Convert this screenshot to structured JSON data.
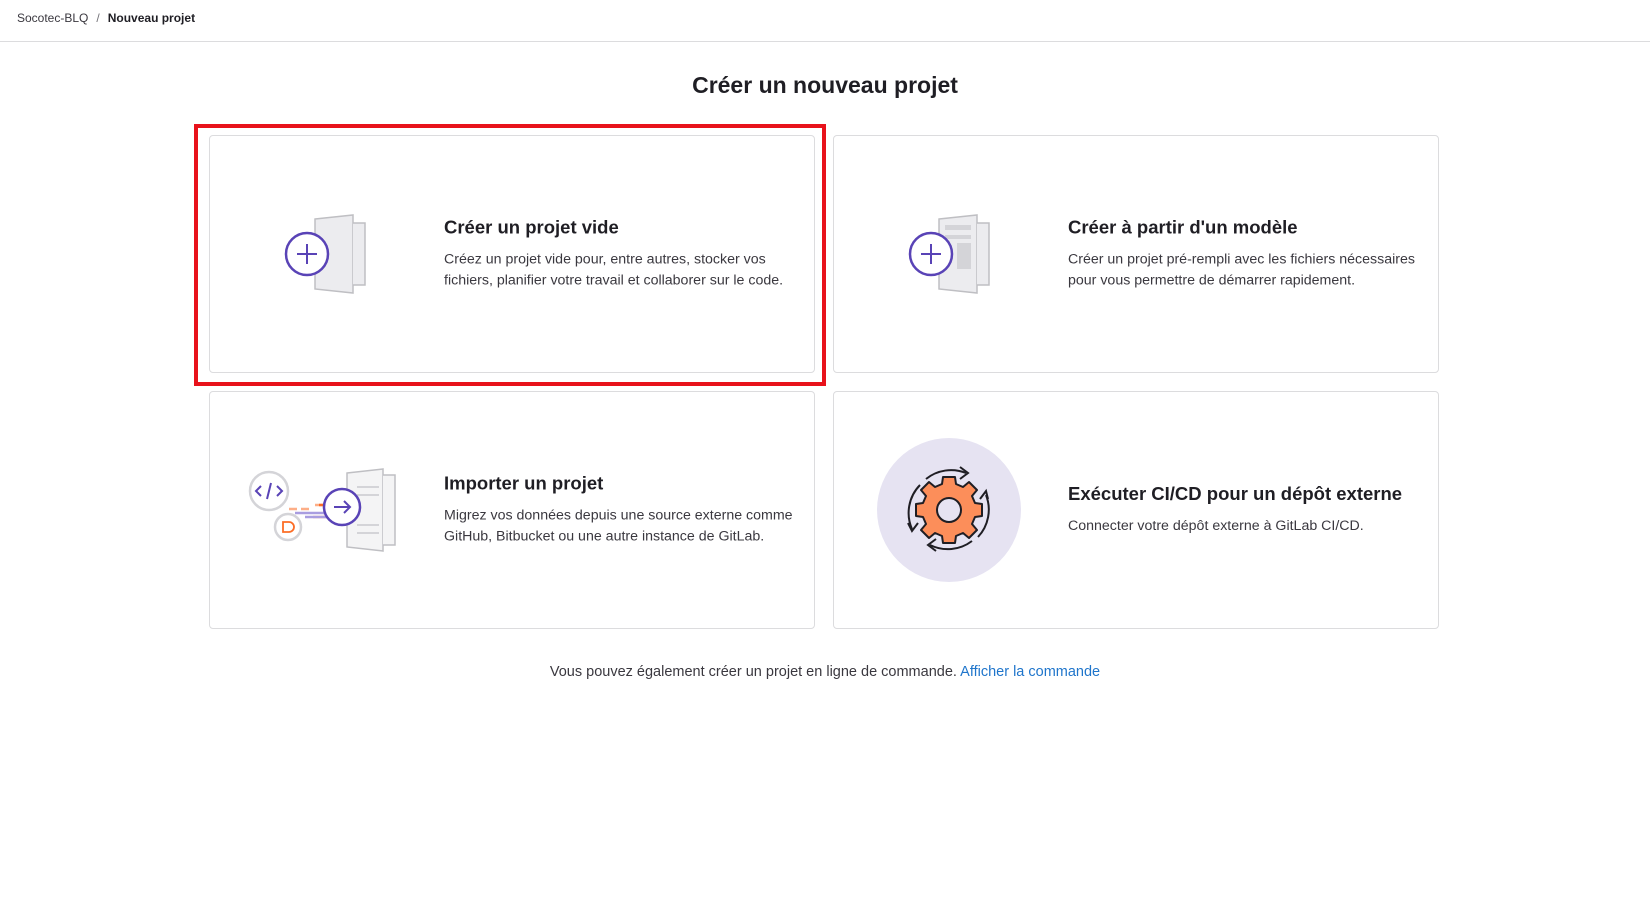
{
  "breadcrumb": {
    "group": "Socotec-BLQ",
    "separator": "/",
    "current": "Nouveau projet"
  },
  "page_title": "Créer un nouveau projet",
  "cards": {
    "blank": {
      "title": "Créer un projet vide",
      "description": "Créez un projet vide pour, entre autres, stocker vos fichiers, planifier votre travail et collaborer sur le code.",
      "icon": "blank-project-icon"
    },
    "template": {
      "title": "Créer à partir d'un modèle",
      "description": "Créer un projet pré-rempli avec les fichiers nécessaires pour vous permettre de démarrer rapidement.",
      "icon": "template-project-icon"
    },
    "import": {
      "title": "Importer un projet",
      "description": "Migrez vos données depuis une source externe comme GitHub, Bitbucket ou une autre instance de GitLab.",
      "icon": "import-project-icon"
    },
    "cicd": {
      "title": "Exécuter CI/CD pour un dépôt externe",
      "description": "Connecter votre dépôt externe à GitLab CI/CD.",
      "icon": "cicd-gear-icon"
    }
  },
  "footer": {
    "text": "Vous pouvez également créer un projet en ligne de commande.",
    "link": "Afficher la commande"
  },
  "colors": {
    "accent_purple": "#5943b6",
    "link_blue": "#1f75cb",
    "highlight_red": "#e8121b",
    "orange": "#fc6d26"
  }
}
